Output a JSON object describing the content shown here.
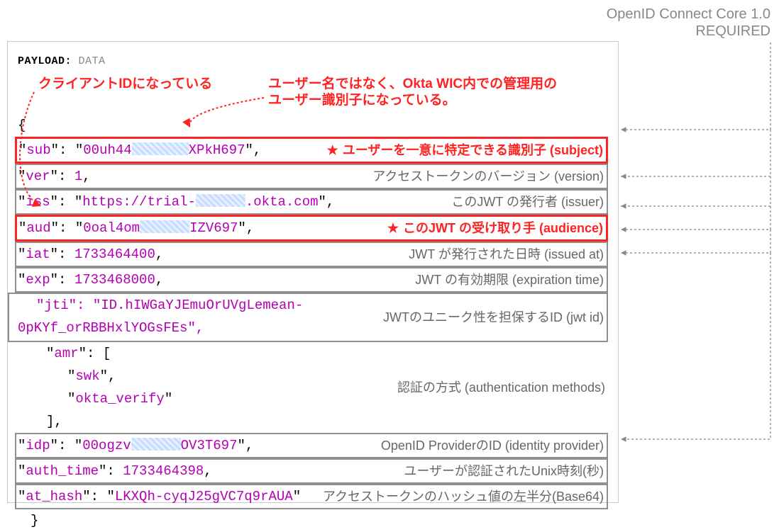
{
  "header": {
    "line1": "OpenID Connect Core 1.0",
    "line2": "REQUIRED"
  },
  "panel_title_strong": "PAYLOAD:",
  "panel_title_rest": "DATA",
  "annotations": {
    "client_id": "クライアントIDになっている",
    "sub_note_l1": "ユーザー名ではなく、Okta WIC内での管理用の",
    "sub_note_l2": "ユーザー識別子になっている。"
  },
  "claims": {
    "sub": {
      "prefix": "00uh44",
      "suffix": "XPkH697",
      "label": "ユーザーを一意に特定できる識別子 (subject)"
    },
    "ver": {
      "value": "1",
      "label": "アクセストークンのバージョン (version)"
    },
    "iss": {
      "prefix": "https://trial-",
      "suffix": ".okta.com",
      "label": "このJWT の発行者 (issuer)"
    },
    "aud": {
      "prefix": "0oal4om",
      "suffix": "IZV697",
      "label": "このJWT の受け取り手 (audience)"
    },
    "iat": {
      "value": "1733464400",
      "label": "JWT が発行された日時 (issued at)"
    },
    "exp": {
      "value": "1733468000",
      "label": "JWT の有効期限 (expiration time)"
    },
    "jti": {
      "line1": "\"jti\": \"ID.hIWGaYJEmuOrUVgLemean-",
      "line2": "0pKYf_orRBBHxlYOGsFEs\",",
      "label": "JWTのユニーク性を担保するID (jwt id)"
    },
    "amr": {
      "v1": "swk",
      "v2": "okta_verify",
      "label": "認証の方式 (authentication methods)"
    },
    "idp": {
      "prefix": "00ogzv",
      "suffix": "OV3T697",
      "label": "OpenID ProviderのID (identity provider)"
    },
    "auth_time": {
      "value": "1733464398",
      "label": "ユーザーが認証されたUnix時刻(秒)"
    },
    "at_hash": {
      "value": "LKXQh-cyqJ25gVC7q9rAUA",
      "label": "アクセストークンのハッシュ値の左半分(Base64)"
    }
  },
  "star": "★"
}
